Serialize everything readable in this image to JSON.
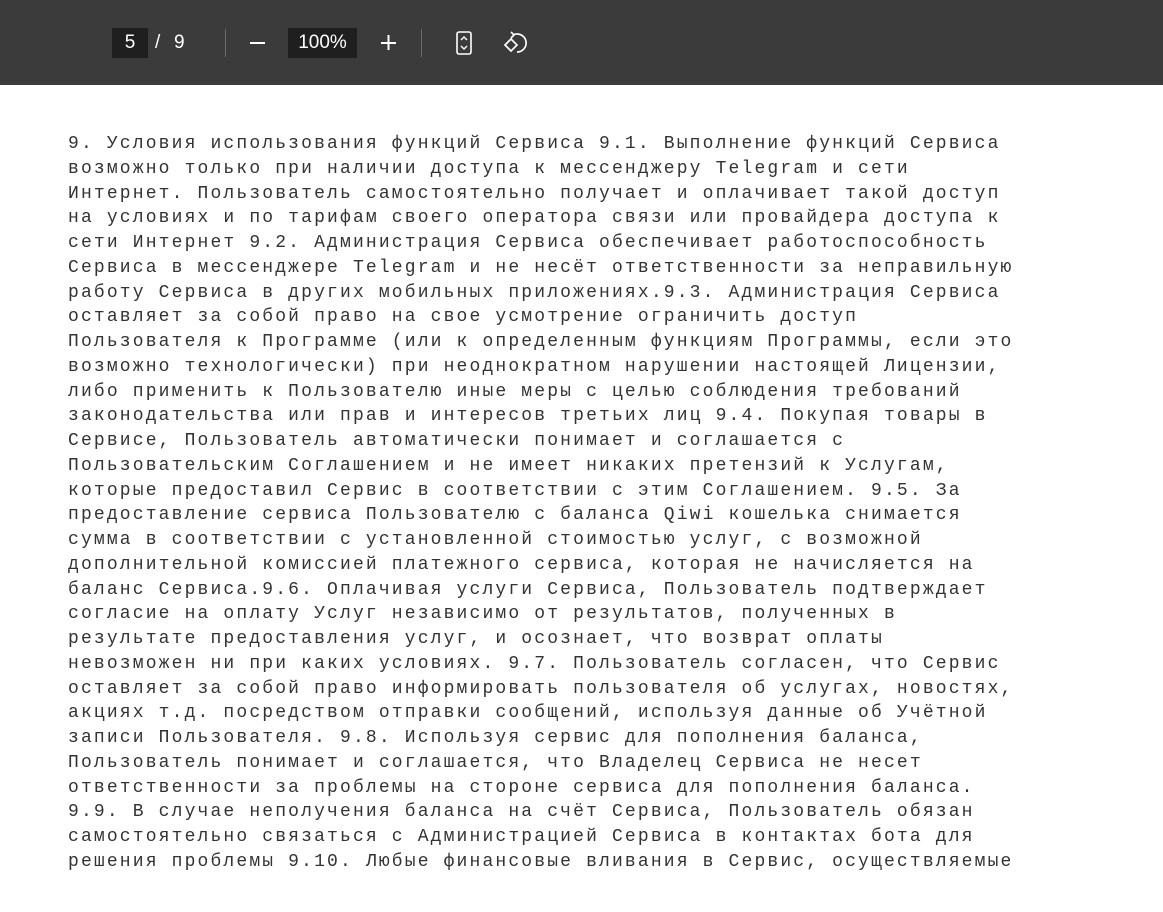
{
  "toolbar": {
    "current_page": "5",
    "page_separator": "/",
    "total_pages": "9",
    "zoom": "100%",
    "zoom_out_icon": "minus-icon",
    "zoom_in_icon": "plus-icon",
    "fit_icon": "fit-page-icon",
    "rotate_icon": "rotate-icon"
  },
  "document": {
    "lines": [
      "9. Условия использования функций Сервиса 9.1. Выполнение функций Сервиса",
      "возможно только при наличии доступа к мессенджеру Telegram и сети",
      "Интернет. Пользователь самостоятельно получает и оплачивает такой доступ",
      "на условиях и по тарифам своего оператора связи или провайдера доступа к",
      "сети Интернет 9.2. Администрация Сервиса обеспечивает работоспособность",
      "Сервиса в мессенджере Telegram и не несёт ответственности за неправильную",
      "работу Сервиса в других мобильных приложениях.9.3. Администрация Сервиса",
      "оставляет за собой право на свое усмотрение ограничить доступ",
      "Пользователя к Программе (или к определенным функциям Программы, если это",
      "возможно технологически) при неоднократном нарушении настоящей Лицензии,",
      "либо применить к Пользователю иные меры с целью соблюдения требований",
      "законодательства или прав и интересов третьих лиц 9.4. Покупая товары в",
      "Сервисе, Пользователь автоматически понимает и соглашается с",
      "Пользовательским Соглашением и не имеет никаких претензий к Услугам,",
      "которые предоставил Сервис в соответствии с этим Соглашением. 9.5. За",
      "предоставление сервиса Пользователю с баланса Qiwi кошелька снимается",
      "сумма в соответствии с установленной стоимостью услуг, с возможной",
      "дополнительной комиссией платежного сервиса, которая не начисляется на",
      "баланс Сервиса.9.6. Оплачивая услуги Сервиса, Пользователь подтверждает",
      "согласие на оплату Услуг независимо от результатов, полученных в",
      "результате предоставления услуг, и осознает, что возврат оплаты",
      "невозможен ни при каких условиях. 9.7. Пользователь согласен, что Сервис",
      "оставляет за собой право информировать пользователя об услугах, новостях,",
      "акциях т.д. посредством отправки сообщений, используя данные об Учётной",
      "записи Пользователя. 9.8. Используя сервис для пополнения баланса,",
      "Пользователь понимает и соглашается, что Владелец Сервиса не несет",
      "ответственности за проблемы на стороне сервиса для пополнения баланса.",
      "9.9. В случае неполучения баланса на счёт Сервиса, Пользователь обязан",
      "самостоятельно связаться с Администрацией Сервиса в контактах бота для",
      "решения проблемы 9.10. Любые финансовые вливания в Сервис, осуществляемые"
    ]
  }
}
